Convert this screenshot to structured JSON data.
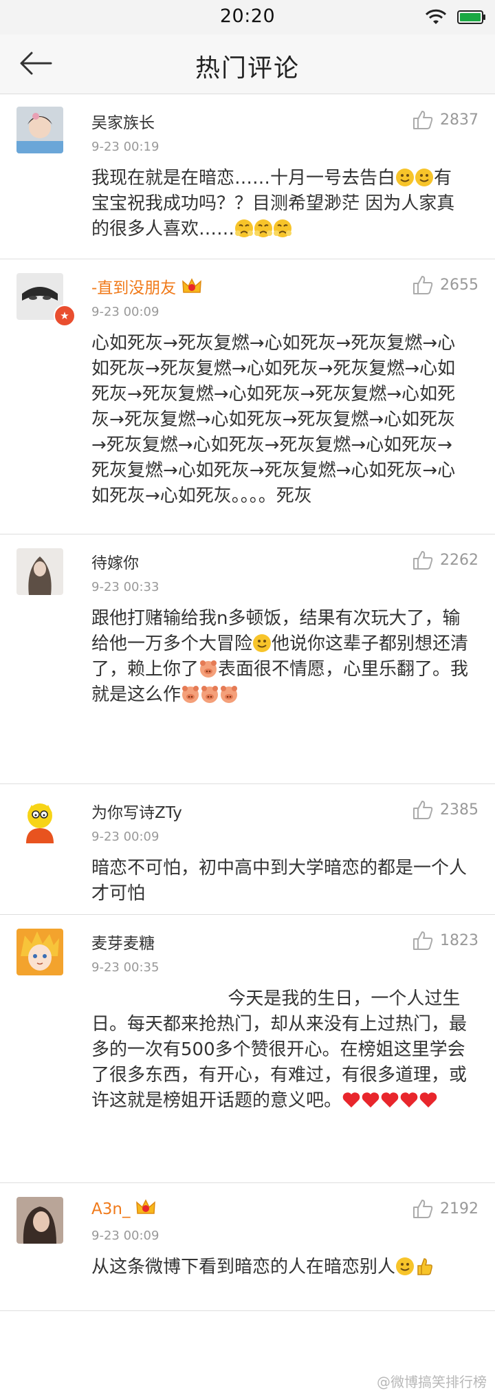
{
  "status_bar": {
    "time": "20:20"
  },
  "header": {
    "title": "热门评论"
  },
  "colors": {
    "orange_name": "#f07a1a",
    "gray_text": "#999999",
    "heart": "#e8262c",
    "emoji_yellow": "#f7c42a"
  },
  "comments": [
    {
      "username": "吴家族长",
      "time": "9-23 00:19",
      "likes": "2837",
      "text": "我现在就是在暗恋……十月一号去告白",
      "text2": "有宝宝祝我成功吗？？目测希望渺茫 因为人家真的很多人喜欢……"
    },
    {
      "username": "-直到没朋友",
      "time": "9-23 00:09",
      "likes": "2655",
      "text": "心如死灰→死灰复燃→心如死灰→死灰复燃→心如死灰→死灰复燃→心如死灰→死灰复燃→心如死灰→死灰复燃→心如死灰→死灰复燃→心如死灰→死灰复燃→心如死灰→死灰复燃→心如死灰→死灰复燃→心如死灰→死灰复燃→心如死灰→死灰复燃→心如死灰→死灰复燃→心如死灰→心如死灰→心如死灰。。。。死灰"
    },
    {
      "username": "待嫁你",
      "time": "9-23 00:33",
      "likes": "2262",
      "text": "跟他打赌输给我n多顿饭，结果有次玩大了，输给他一万多个大冒险",
      "text2": "他说你这辈子都别想还清了，赖上你了",
      "text3": "表面很不情愿，心里乐翻了。我就是这么作"
    },
    {
      "username": "为你写诗ZTy",
      "time": "9-23 00:09",
      "likes": "2385",
      "text": "暗恋不可怕，初中高中到大学暗恋的都是一个人才可怕"
    },
    {
      "username": "麦芽麦糖",
      "time": "9-23 00:35",
      "likes": "1823",
      "text": "                        今天是我的生日，一个人过生日。每天都来抢热门，却从来没有上过热门，最多的一次有500多个赞很开心。在榜姐这里学会了很多东西，有开心，有难过，有很多道理，或许这就是榜姐开话题的意义吧。"
    },
    {
      "username": "A3n_",
      "time": "9-23 00:09",
      "likes": "2192",
      "text": "从这条微博下看到暗恋的人在暗恋别人"
    }
  ],
  "footer": {
    "watermark": "@微博搞笑排行榜"
  }
}
